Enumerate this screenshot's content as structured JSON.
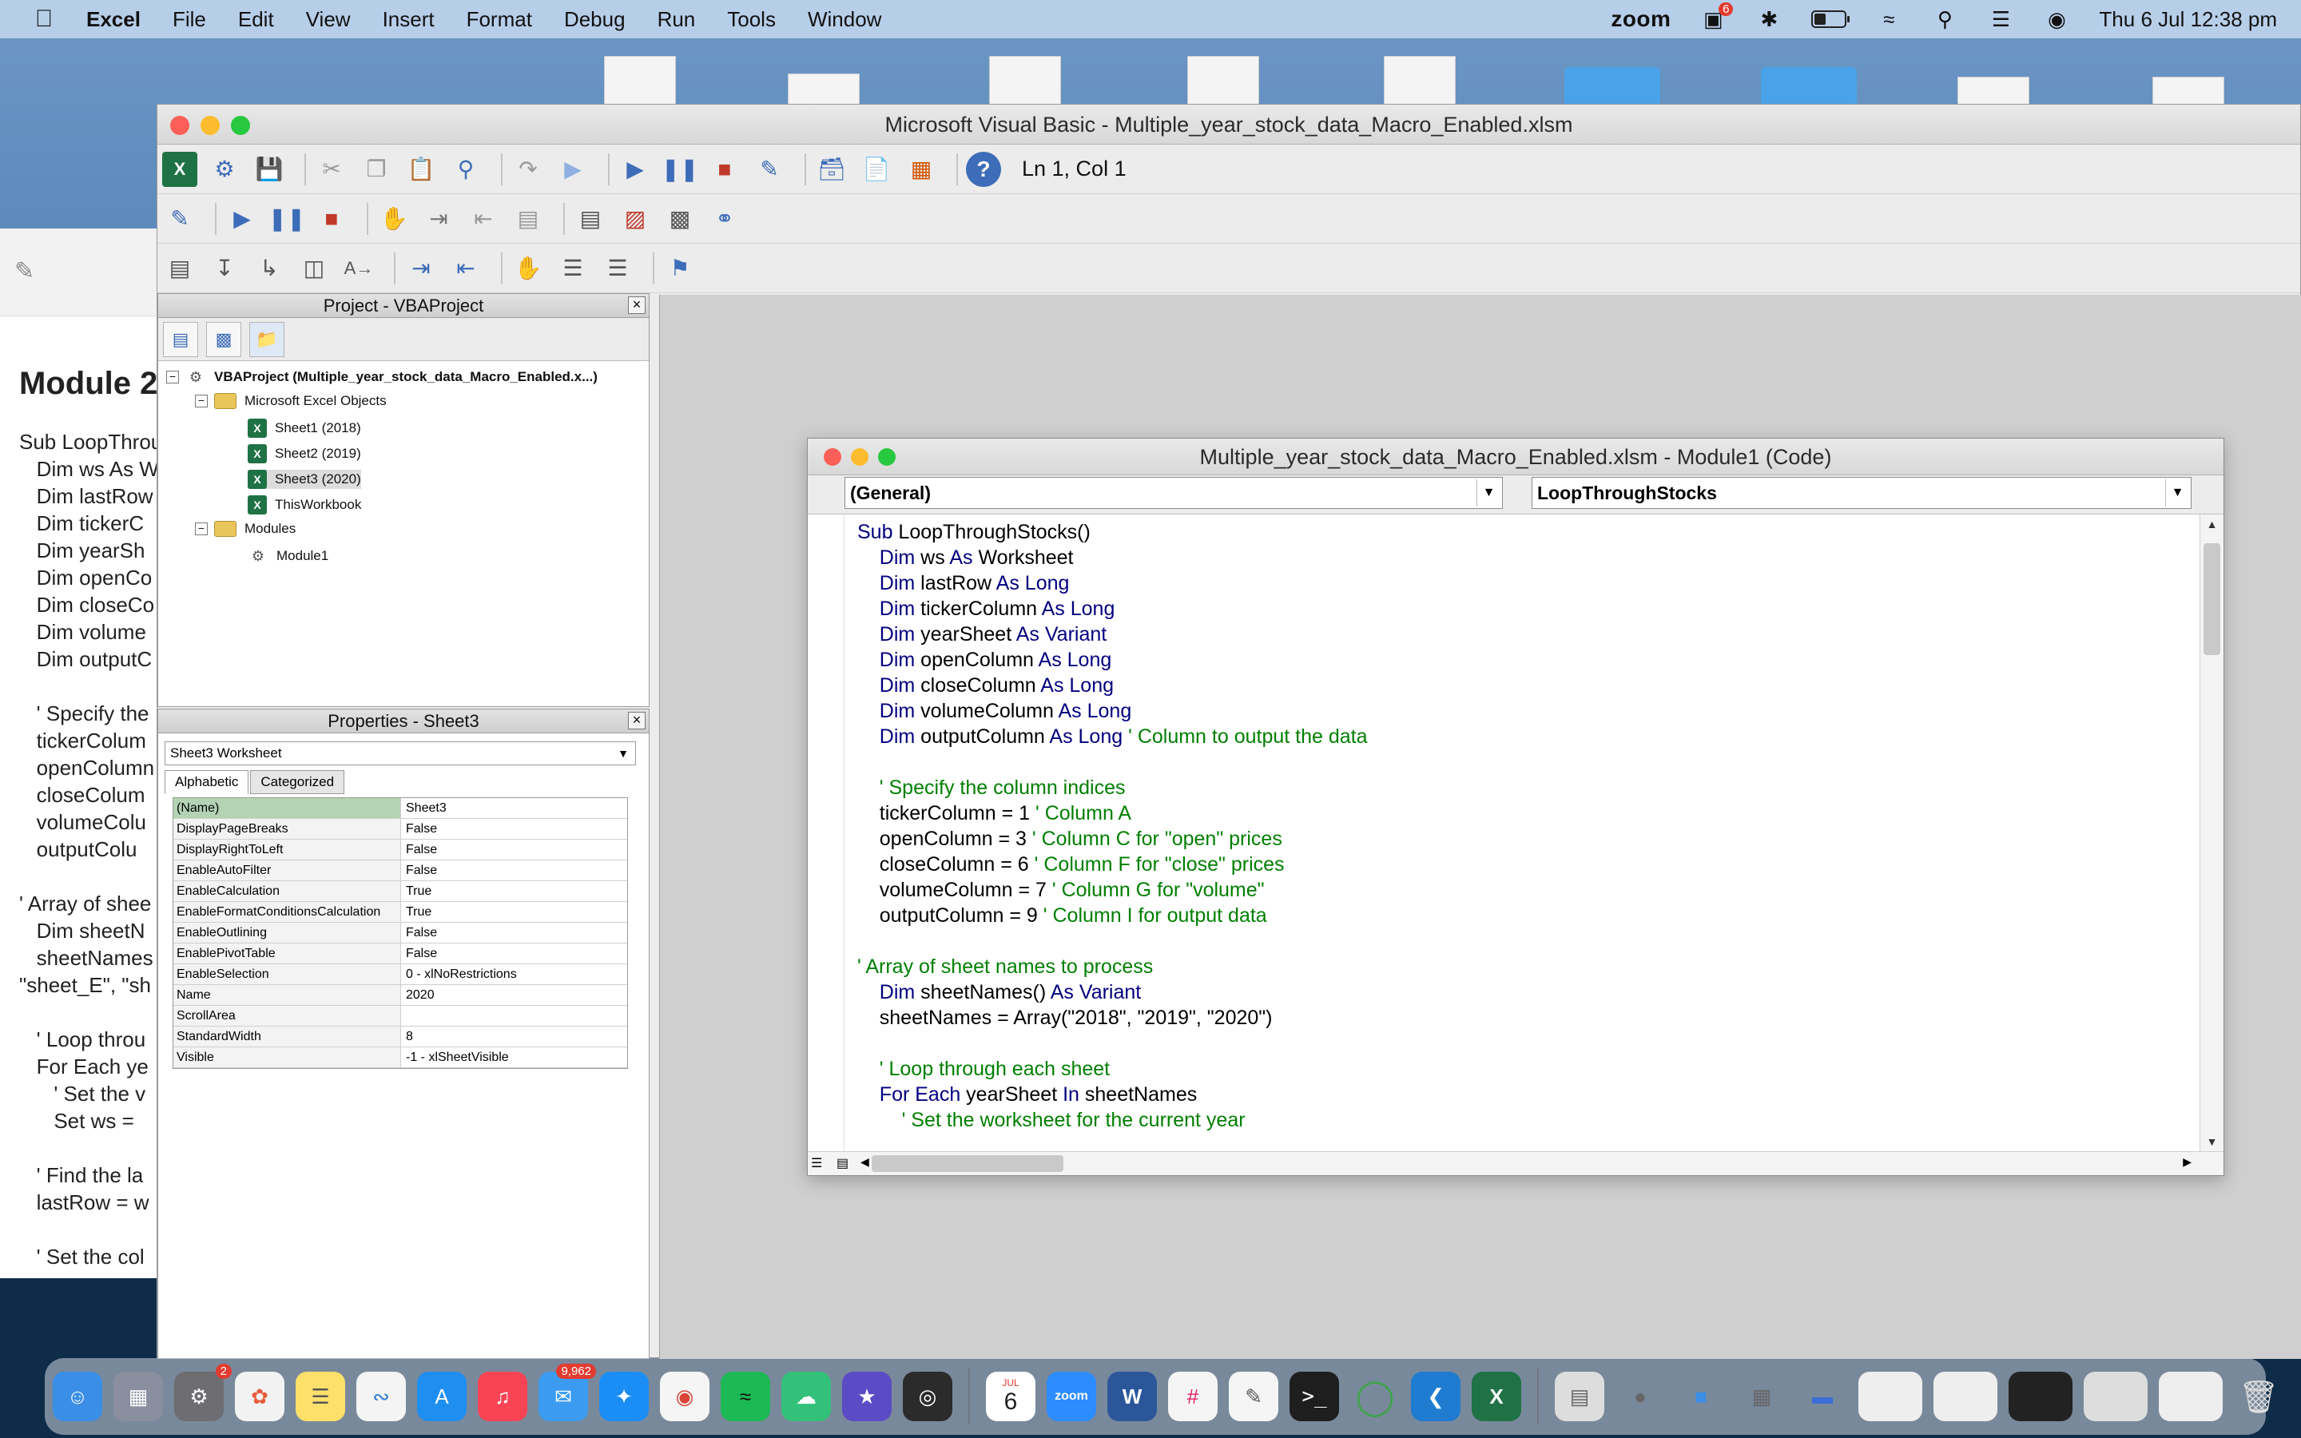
{
  "menubar": {
    "app_name": "Excel",
    "items": [
      "File",
      "Edit",
      "View",
      "Insert",
      "Format",
      "Debug",
      "Run",
      "Tools",
      "Window"
    ],
    "zoom_label": "zoom",
    "zoom_badge": "6",
    "datetime": "Thu 6 Jul  12:38 pm"
  },
  "doc_behind": {
    "heading": "Module 2",
    "lines": [
      "Sub LoopThrou",
      "   Dim ws As W",
      "   Dim lastRow",
      "   Dim tickerC",
      "   Dim yearSh",
      "   Dim openCo",
      "   Dim closeCo",
      "   Dim volume",
      "   Dim outputC",
      "",
      "   ' Specify the",
      "   tickerColum",
      "   openColumn",
      "   closeColum",
      "   volumeColu",
      "   outputColu",
      "",
      "' Array of shee",
      "   Dim sheetN",
      "   sheetNames",
      "\"sheet_E\", \"sh",
      "",
      "   ' Loop throu",
      "   For Each ye",
      "      ' Set the v",
      "      Set ws = ",
      "",
      "   ' Find the la",
      "   lastRow = w",
      "",
      "   ' Set the col"
    ]
  },
  "vba": {
    "title": "Microsoft Visual Basic - Multiple_year_stock_data_Macro_Enabled.xlsm",
    "status": "Ln 1, Col 1"
  },
  "project": {
    "title": "Project - VBAProject",
    "root": "VBAProject (Multiple_year_stock_data_Macro_Enabled.x...)",
    "excel_objects": "Microsoft Excel Objects",
    "sheets": [
      "Sheet1 (2018)",
      "Sheet2 (2019)",
      "Sheet3 (2020)",
      "ThisWorkbook"
    ],
    "modules_folder": "Modules",
    "module": "Module1"
  },
  "properties": {
    "title": "Properties - Sheet3",
    "object_select": "Sheet3  Worksheet",
    "tabs": [
      "Alphabetic",
      "Categorized"
    ],
    "rows": [
      {
        "name": "(Name)",
        "value": "Sheet3"
      },
      {
        "name": "DisplayPageBreaks",
        "value": "False"
      },
      {
        "name": "DisplayRightToLeft",
        "value": "False"
      },
      {
        "name": "EnableAutoFilter",
        "value": "False"
      },
      {
        "name": "EnableCalculation",
        "value": "True"
      },
      {
        "name": "EnableFormatConditionsCalculation",
        "value": "True"
      },
      {
        "name": "EnableOutlining",
        "value": "False"
      },
      {
        "name": "EnablePivotTable",
        "value": "False"
      },
      {
        "name": "EnableSelection",
        "value": "0 - xlNoRestrictions"
      },
      {
        "name": "Name",
        "value": "2020"
      },
      {
        "name": "ScrollArea",
        "value": ""
      },
      {
        "name": "StandardWidth",
        "value": "8"
      },
      {
        "name": "Visible",
        "value": "-1 - xlSheetVisible"
      }
    ]
  },
  "code_window": {
    "title": "Multiple_year_stock_data_Macro_Enabled.xlsm - Module1 (Code)",
    "object_combo": "(General)",
    "proc_combo": "LoopThroughStocks",
    "lines": [
      [
        {
          "t": "Sub",
          "c": "kw"
        },
        {
          "t": " LoopThroughStocks()",
          "c": ""
        }
      ],
      [
        {
          "t": "    ",
          "c": ""
        },
        {
          "t": "Dim",
          "c": "kw"
        },
        {
          "t": " ws ",
          "c": ""
        },
        {
          "t": "As",
          "c": "kw"
        },
        {
          "t": " Worksheet",
          "c": ""
        }
      ],
      [
        {
          "t": "    ",
          "c": ""
        },
        {
          "t": "Dim",
          "c": "kw"
        },
        {
          "t": " lastRow ",
          "c": ""
        },
        {
          "t": "As Long",
          "c": "kw"
        }
      ],
      [
        {
          "t": "    ",
          "c": ""
        },
        {
          "t": "Dim",
          "c": "kw"
        },
        {
          "t": " tickerColumn ",
          "c": ""
        },
        {
          "t": "As Long",
          "c": "kw"
        }
      ],
      [
        {
          "t": "    ",
          "c": ""
        },
        {
          "t": "Dim",
          "c": "kw"
        },
        {
          "t": " yearSheet ",
          "c": ""
        },
        {
          "t": "As Variant",
          "c": "kw"
        }
      ],
      [
        {
          "t": "    ",
          "c": ""
        },
        {
          "t": "Dim",
          "c": "kw"
        },
        {
          "t": " openColumn ",
          "c": ""
        },
        {
          "t": "As Long",
          "c": "kw"
        }
      ],
      [
        {
          "t": "    ",
          "c": ""
        },
        {
          "t": "Dim",
          "c": "kw"
        },
        {
          "t": " closeColumn ",
          "c": ""
        },
        {
          "t": "As Long",
          "c": "kw"
        }
      ],
      [
        {
          "t": "    ",
          "c": ""
        },
        {
          "t": "Dim",
          "c": "kw"
        },
        {
          "t": " volumeColumn ",
          "c": ""
        },
        {
          "t": "As Long",
          "c": "kw"
        }
      ],
      [
        {
          "t": "    ",
          "c": ""
        },
        {
          "t": "Dim",
          "c": "kw"
        },
        {
          "t": " outputColumn ",
          "c": ""
        },
        {
          "t": "As Long",
          "c": "kw"
        },
        {
          "t": " ' Column to output the data",
          "c": "cm"
        }
      ],
      [],
      [
        {
          "t": "    ' Specify the column indices",
          "c": "cm"
        }
      ],
      [
        {
          "t": "    tickerColumn = 1 ",
          "c": ""
        },
        {
          "t": "' Column A",
          "c": "cm"
        }
      ],
      [
        {
          "t": "    openColumn = 3 ",
          "c": ""
        },
        {
          "t": "' Column C for \"open\" prices",
          "c": "cm"
        }
      ],
      [
        {
          "t": "    closeColumn = 6 ",
          "c": ""
        },
        {
          "t": "' Column F for \"close\" prices",
          "c": "cm"
        }
      ],
      [
        {
          "t": "    volumeColumn = 7 ",
          "c": ""
        },
        {
          "t": "' Column G for \"volume\"",
          "c": "cm"
        }
      ],
      [
        {
          "t": "    outputColumn = 9 ",
          "c": ""
        },
        {
          "t": "' Column I for output data",
          "c": "cm"
        }
      ],
      [],
      [
        {
          "t": "' Array of sheet names to process",
          "c": "cm"
        }
      ],
      [
        {
          "t": "    ",
          "c": ""
        },
        {
          "t": "Dim",
          "c": "kw"
        },
        {
          "t": " sheetNames() ",
          "c": ""
        },
        {
          "t": "As Variant",
          "c": "kw"
        }
      ],
      [
        {
          "t": "    sheetNames = Array(\"2018\", \"2019\", \"2020\")",
          "c": ""
        }
      ],
      [],
      [
        {
          "t": "    ' Loop through each sheet",
          "c": "cm"
        }
      ],
      [
        {
          "t": "    ",
          "c": ""
        },
        {
          "t": "For Each",
          "c": "kw"
        },
        {
          "t": " yearSheet ",
          "c": ""
        },
        {
          "t": "In",
          "c": "kw"
        },
        {
          "t": " sheetNames",
          "c": ""
        }
      ],
      [
        {
          "t": "        ' Set the worksheet for the current year",
          "c": "cm"
        }
      ]
    ]
  },
  "dock": {
    "settings_badge": "2",
    "mail_badge": "9,962",
    "calendar_month": "JUL",
    "calendar_day": "6",
    "zoom_label": "zoom"
  },
  "colors": {
    "keyword": "#00007f",
    "comment": "#007f00",
    "accent": "#3d6cb8"
  }
}
